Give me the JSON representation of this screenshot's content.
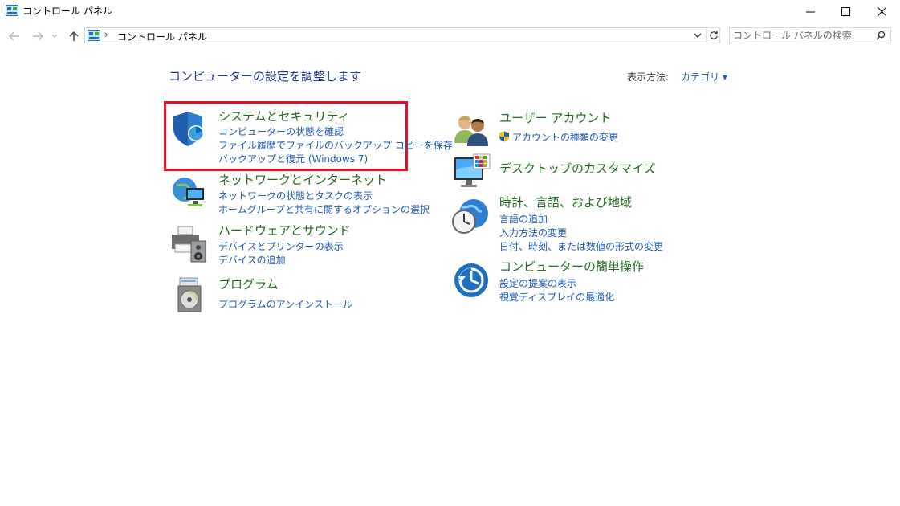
{
  "window": {
    "title": "コントロール パネル"
  },
  "address": {
    "path": "コントロール パネル",
    "separator": "›"
  },
  "search": {
    "placeholder": "コントロール パネルの検索"
  },
  "header": {
    "title": "コンピューターの設定を調整します",
    "view_by_label": "表示方法:",
    "view_by_value": "カテゴリ ▾"
  },
  "categories": [
    {
      "title": "システムとセキュリティ",
      "icon": "shield-icon",
      "links": [
        "コンピューターの状態を確認",
        "ファイル履歴でファイルのバックアップ コピーを保存",
        "バックアップと復元 (Windows 7)"
      ]
    },
    {
      "title": "ネットワークとインターネット",
      "icon": "network-globe-icon",
      "links": [
        "ネットワークの状態とタスクの表示",
        "ホームグループと共有に関するオプションの選択"
      ]
    },
    {
      "title": "ハードウェアとサウンド",
      "icon": "printer-speaker-icon",
      "links": [
        "デバイスとプリンターの表示",
        "デバイスの追加"
      ]
    },
    {
      "title": "プログラム",
      "icon": "programs-disc-icon",
      "links": [
        "プログラムのアンインストール"
      ]
    },
    {
      "title": "ユーザー アカウント",
      "icon": "users-icon",
      "links": [
        "アカウントの種類の変更"
      ]
    },
    {
      "title": "デスクトップのカスタマイズ",
      "icon": "monitor-palette-icon",
      "links": []
    },
    {
      "title": "時計、言語、および地域",
      "icon": "clock-globe-icon",
      "links": [
        "言語の追加",
        "入力方法の変更",
        "日付、時刻、または数値の形式の変更"
      ]
    },
    {
      "title": "コンピューターの簡単操作",
      "icon": "ease-of-access-icon",
      "links": [
        "設定の提案の表示",
        "視覚ディスプレイの最適化"
      ]
    }
  ],
  "colors": {
    "highlight": "#e81123",
    "category_title": "#1f6a1f",
    "link": "#1a5bb8",
    "page_title": "#1e3287"
  }
}
